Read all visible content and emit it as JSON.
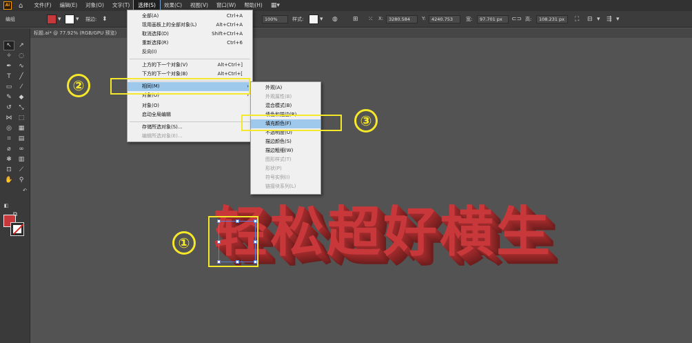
{
  "app": {
    "logo_text": "Ai"
  },
  "menubar": {
    "items": [
      "文件(F)",
      "编辑(E)",
      "对象(O)",
      "文字(T)",
      "选择(S)",
      "效果(C)",
      "视图(V)",
      "窗口(W)",
      "帮助(H)"
    ],
    "active_index": 4
  },
  "controlbar": {
    "mode_label": "编组",
    "stroke_label": "描边:",
    "opacity_value": "100%",
    "style_label": "样式:",
    "x_label": "X:",
    "x_value": "3280.584",
    "y_label": "Y:",
    "y_value": "4240.753",
    "w_label": "宽:",
    "w_value": "97.701 px",
    "h_label": "高:",
    "h_value": "108.231 px",
    "fill_color": "#c8383a"
  },
  "document": {
    "tab_title": "标题.ai* @ 77.92% (RGB/GPU 预览)"
  },
  "select_menu": {
    "items": [
      {
        "label": "全部(A)",
        "shortcut": "Ctrl+A"
      },
      {
        "label": "现用画板上的全部对象(L)",
        "shortcut": "Alt+Ctrl+A"
      },
      {
        "label": "取消选择(D)",
        "shortcut": "Shift+Ctrl+A"
      },
      {
        "label": "重新选择(R)",
        "shortcut": "Ctrl+6"
      },
      {
        "label": "反向(I)",
        "shortcut": ""
      },
      {
        "label": "上方的下一个对象(V)",
        "shortcut": "Alt+Ctrl+]"
      },
      {
        "label": "下方的下一个对象(B)",
        "shortcut": "Alt+Ctrl+["
      },
      {
        "label": "相同(M)",
        "shortcut": ""
      },
      {
        "label": "对象(O)",
        "shortcut": ""
      },
      {
        "label": "对象(O)",
        "shortcut": ""
      },
      {
        "label": "启动全局编辑",
        "shortcut": ""
      },
      {
        "label": "存储所选对象(S)...",
        "shortcut": ""
      },
      {
        "label": "编辑所选对象(E)...",
        "shortcut": ""
      }
    ]
  },
  "same_submenu": {
    "items": [
      {
        "label": "外观(A)",
        "disabled": false
      },
      {
        "label": "外观属性(B)",
        "disabled": true
      },
      {
        "label": "混合模式(B)",
        "disabled": false
      },
      {
        "label": "填色和描边(R)",
        "disabled": false
      },
      {
        "label": "填充颜色(F)",
        "disabled": false
      },
      {
        "label": "不透明度(O)",
        "disabled": false
      },
      {
        "label": "描边颜色(S)",
        "disabled": false
      },
      {
        "label": "描边粗细(W)",
        "disabled": false
      },
      {
        "label": "图形样式(T)",
        "disabled": true
      },
      {
        "label": "形状(P)",
        "disabled": true
      },
      {
        "label": "符号实例(I)",
        "disabled": true
      },
      {
        "label": "链接块系列(L)",
        "disabled": true
      }
    ],
    "highlight_index": 4
  },
  "annotations": {
    "step1": "①",
    "step2": "②",
    "step3": "③",
    "color": "#f5e82a"
  },
  "artwork": {
    "text": "轻松超好横生",
    "color": "#c8383a"
  },
  "toolbar": {
    "more_label": "..."
  }
}
